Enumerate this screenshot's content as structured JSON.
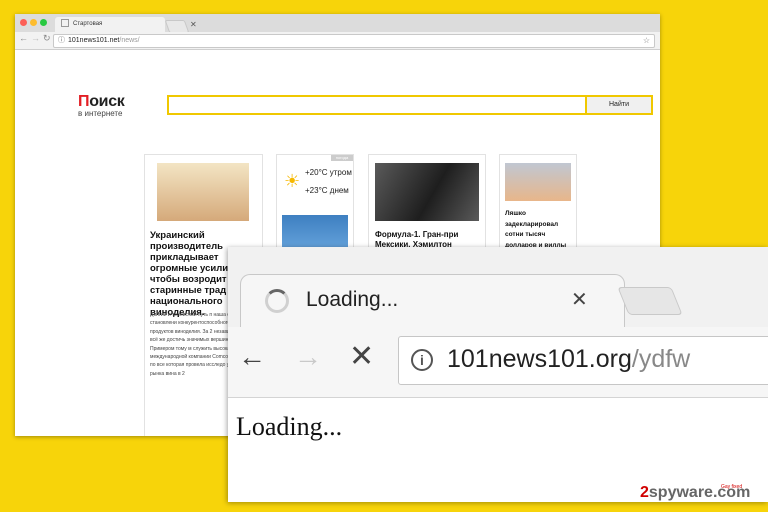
{
  "back_browser": {
    "tab_title": "Стартовая",
    "url_host": "101news101.net",
    "url_path": "/news/",
    "search_button": "Найти",
    "logo_first": "П",
    "logo_rest": "оиск",
    "logo_sub": "в интернете",
    "cards": [
      {
        "title": "Украинский производитель прикладывает огромные усили чтобы возродит старинные трад национального виноделия.",
        "body": "Долгий и тернистый путь п наша страна в становлени конкурентоспособного рын продуктов виноделия. За 2 независимости нам всё же достичь значимых вершин отрасли. Примером тому м служить высокая отметка международной компании Comcon (87 офисов по все которая провела исследо украинского рынка вина в 2"
      },
      {
        "temp1": "+20°C утром",
        "temp2": "+23°C днем",
        "tag": "погода"
      },
      {
        "title": "Формула-1. Гран-при Мексики. Хэмилтон"
      },
      {
        "title": "Ляшко задекларировал сотни тысяч долларов и виллы"
      }
    ]
  },
  "front_browser": {
    "tab_title": "Loading...",
    "url_host": "101news101.org",
    "url_path": "/ydfw",
    "page_text": "Loading..."
  },
  "watermark": {
    "digit": "2",
    "text": "spyware.com",
    "sub": "Gay fixed"
  },
  "icons": {
    "back": "back-arrow-icon",
    "forward": "forward-arrow-icon",
    "stop": "stop-icon",
    "info": "info-icon",
    "spinner": "loading-spinner-icon",
    "close": "close-icon"
  }
}
